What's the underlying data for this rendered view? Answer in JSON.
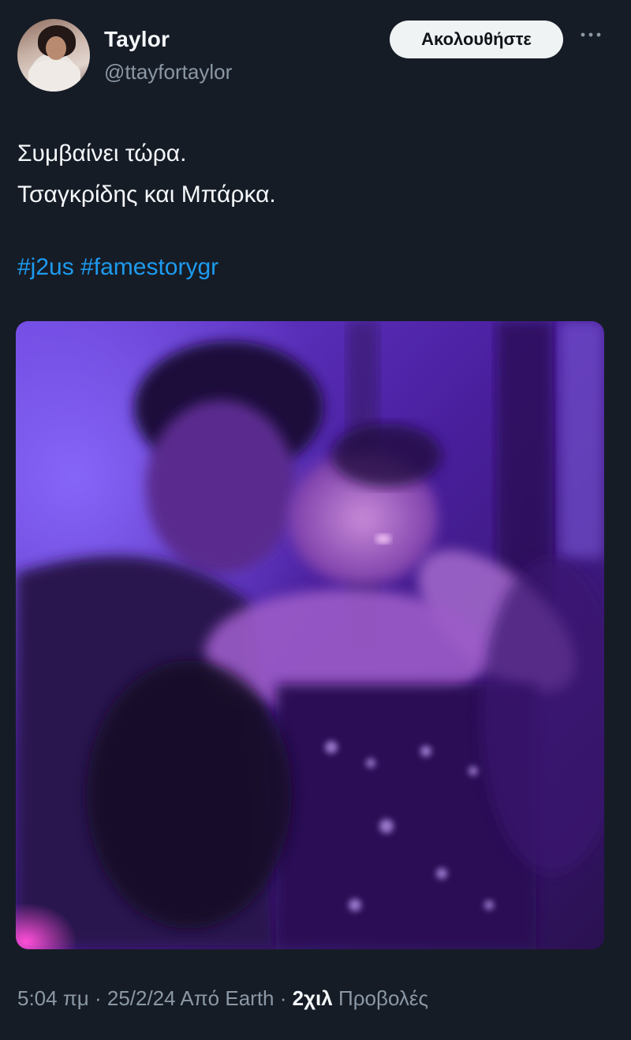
{
  "author": {
    "name": "Taylor",
    "handle": "@ttayfortaylor"
  },
  "follow_label": "Ακολουθήστε",
  "more_icon": "more-horizontal-icon",
  "tweet": {
    "lines": [
      "Συμβαίνει τώρα.",
      "Τσαγκρίδης και Μπάρκα."
    ],
    "hashtags": [
      "#j2us",
      "#famestorygr"
    ]
  },
  "meta": {
    "time": "5:04 πμ",
    "sep1": " · ",
    "date": "25/2/24",
    "source": " Από Earth",
    "sep2": " · ",
    "views_count": "2χιλ",
    "views_label": " Προβολές"
  },
  "colors": {
    "background": "#161c26",
    "link": "#1d9bf0",
    "secondary_text": "#8b98a5"
  }
}
